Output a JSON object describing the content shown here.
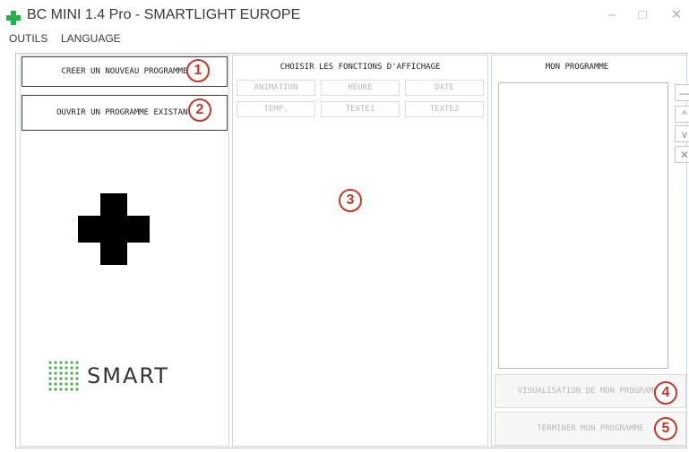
{
  "window": {
    "title": "BC MINI 1.4 Pro - SMARTLIGHT EUROPE",
    "minimize_icon": "minimize-icon",
    "maximize_icon": "maximize-icon",
    "close_icon": "close-icon"
  },
  "menu": {
    "items": [
      {
        "label": "OUTILS"
      },
      {
        "label": "LANGUAGE"
      }
    ]
  },
  "left_panel": {
    "create_button": "CREER UN NOUVEAU PROGRAMME",
    "open_button": "OUVRIR UN PROGRAMME EXISTANT",
    "logo_text": "SMART"
  },
  "middle_panel": {
    "header": "CHOISIR LES FONCTIONS D'AFFICHAGE",
    "function_buttons": [
      {
        "label": "ANIMATION"
      },
      {
        "label": "HEURE"
      },
      {
        "label": "DATE"
      },
      {
        "label": "TEMP."
      },
      {
        "label": "TEXTE1"
      },
      {
        "label": "TEXTE2"
      }
    ]
  },
  "right_panel": {
    "header": "MON PROGRAMME",
    "side_buttons": [
      {
        "icon": "minus-icon",
        "glyph": "—"
      },
      {
        "icon": "arrow-up-icon",
        "glyph": "^"
      },
      {
        "icon": "arrow-down-icon",
        "glyph": "v"
      },
      {
        "icon": "delete-icon",
        "glyph": "✕"
      }
    ],
    "visualize_button": "VISUALISATION DE MON PROGRAMME",
    "finish_button": "TERMINER MON PROGRAMME"
  },
  "annotations": [
    "1",
    "2",
    "3",
    "4",
    "5"
  ],
  "colors": {
    "accent_red": "#c0392b",
    "app_icon_green": "#22b14c",
    "logo_green": "#4caf50"
  }
}
